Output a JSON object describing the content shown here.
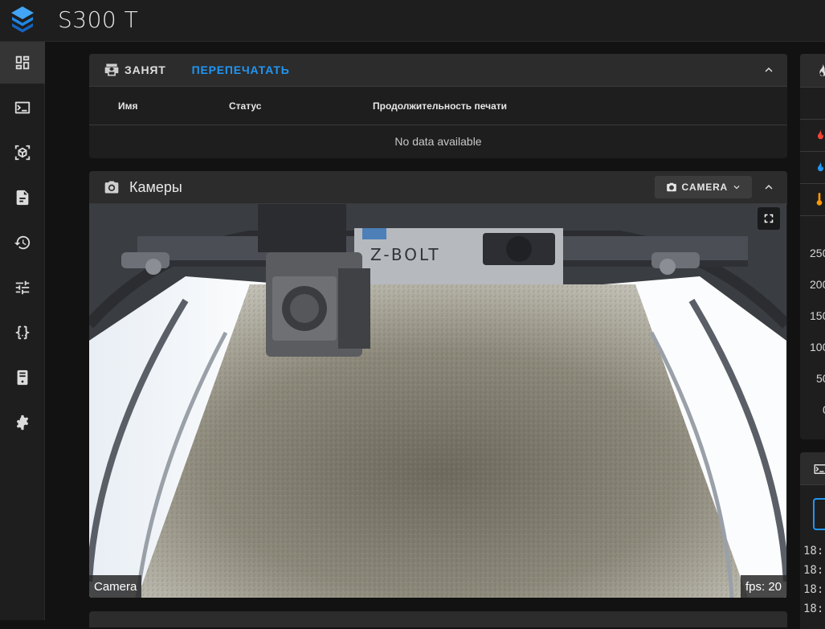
{
  "app": {
    "title": "S300 T"
  },
  "sidebar": {
    "items": [
      {
        "name": "dashboard",
        "icon": "dashboard-icon",
        "active": true
      },
      {
        "name": "console",
        "icon": "console-icon"
      },
      {
        "name": "heightmap",
        "icon": "cube-scan-icon"
      },
      {
        "name": "files",
        "icon": "file-document-icon"
      },
      {
        "name": "history",
        "icon": "history-icon"
      },
      {
        "name": "machine",
        "icon": "tune-icon"
      },
      {
        "name": "config",
        "icon": "code-braces-icon"
      },
      {
        "name": "system",
        "icon": "server-icon"
      },
      {
        "name": "settings",
        "icon": "gear-icon"
      }
    ]
  },
  "status_panel": {
    "state_label": "ЗАНЯТ",
    "reprint_label": "ПЕРЕПЕЧАТАТЬ",
    "columns": [
      "Имя",
      "Статус",
      "Продолжительность печати"
    ],
    "empty_text": "No data available"
  },
  "camera_panel": {
    "title": "Камеры",
    "camera_select": "CAMERA",
    "camera_name": "Camera",
    "fps_text": "fps: 20",
    "printer_brand_text": "Z-BOLT"
  },
  "temperature_panel": {
    "y_ticks": [
      "250",
      "200",
      "150",
      "100",
      "50",
      "0"
    ]
  },
  "console_panel": {
    "lines": [
      "18:",
      "18:",
      "18:",
      "18:"
    ]
  },
  "colors": {
    "accent": "#2196f3",
    "background": "#121212",
    "card": "#1e1e1e",
    "card_header": "#2c2c2c",
    "extruder": "#f44336",
    "bed": "#2196f3",
    "chamber": "#ff9800"
  }
}
